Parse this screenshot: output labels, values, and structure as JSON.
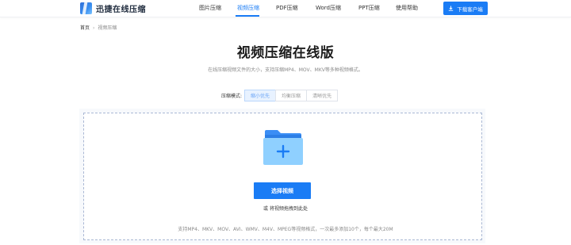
{
  "header": {
    "logo_text": "迅捷在线压缩",
    "nav": [
      {
        "label": "图片压缩",
        "active": false
      },
      {
        "label": "视频压缩",
        "active": true
      },
      {
        "label": "PDF压缩",
        "active": false
      },
      {
        "label": "Word压缩",
        "active": false
      },
      {
        "label": "PPT压缩",
        "active": false
      },
      {
        "label": "使用帮助",
        "active": false
      }
    ],
    "download_label": "下载客户端"
  },
  "breadcrumb": {
    "home": "首页",
    "current": "视频压缩"
  },
  "main": {
    "title": "视频压缩在线版",
    "subtitle": "在线压缩视频文件的大小，支持压缩MP4、MOV、MKV等多种视频格式。"
  },
  "mode": {
    "label": "压缩模式:",
    "options": [
      {
        "label": "缩小优先",
        "active": true
      },
      {
        "label": "均衡压缩",
        "active": false
      },
      {
        "label": "清晰优先",
        "active": false
      }
    ]
  },
  "upload": {
    "choose_label": "选择视频",
    "drag_hint": "或 将视频拖拽到此处",
    "support_text": "支持MP4、MKV、MOV、AVI、WMV、M4V、MPEG等视频格式，一次最多添加10个，每个最大20M"
  },
  "colors": {
    "accent": "#1a7cf5",
    "folder_back": "#3b8ef5",
    "folder_front": "#8fd0ff"
  },
  "icons": {
    "logo": "zipper-logo-icon",
    "download": "download-icon",
    "folder": "folder-add-icon"
  }
}
